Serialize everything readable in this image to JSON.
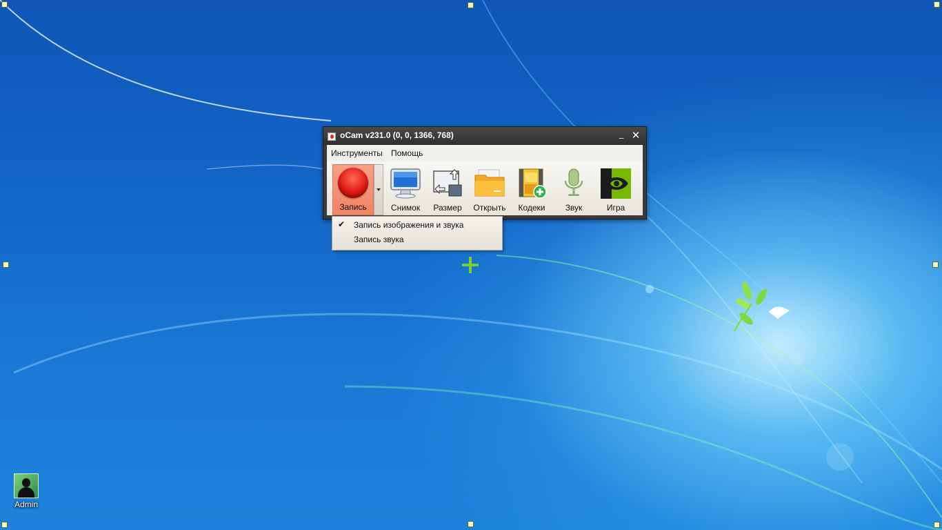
{
  "window": {
    "title": "oCam v231.0 (0, 0, 1366, 768)",
    "minimize_symbol": "_",
    "close_symbol": "✕"
  },
  "menu": {
    "tools": "Инструменты",
    "help": "Помощь"
  },
  "toolbar": {
    "record": "Запись",
    "screenshot": "Снимок",
    "resize": "Размер",
    "open": "Открыть",
    "codecs": "Кодеки",
    "sound": "Звук",
    "game": "Игра"
  },
  "record_menu": {
    "items": [
      {
        "label": "Запись изображения и звука",
        "checked": true,
        "check_symbol": "✔"
      },
      {
        "label": "Запись звука",
        "checked": false
      }
    ]
  },
  "desktop": {
    "icons": [
      {
        "label": "Admin",
        "icon": "user-account-icon"
      }
    ]
  },
  "colors": {
    "record_button": "#f08363",
    "title_bar": "#3a3a3a",
    "selection_handle": "#f2f7c8",
    "crosshair": "#7bd12c"
  }
}
